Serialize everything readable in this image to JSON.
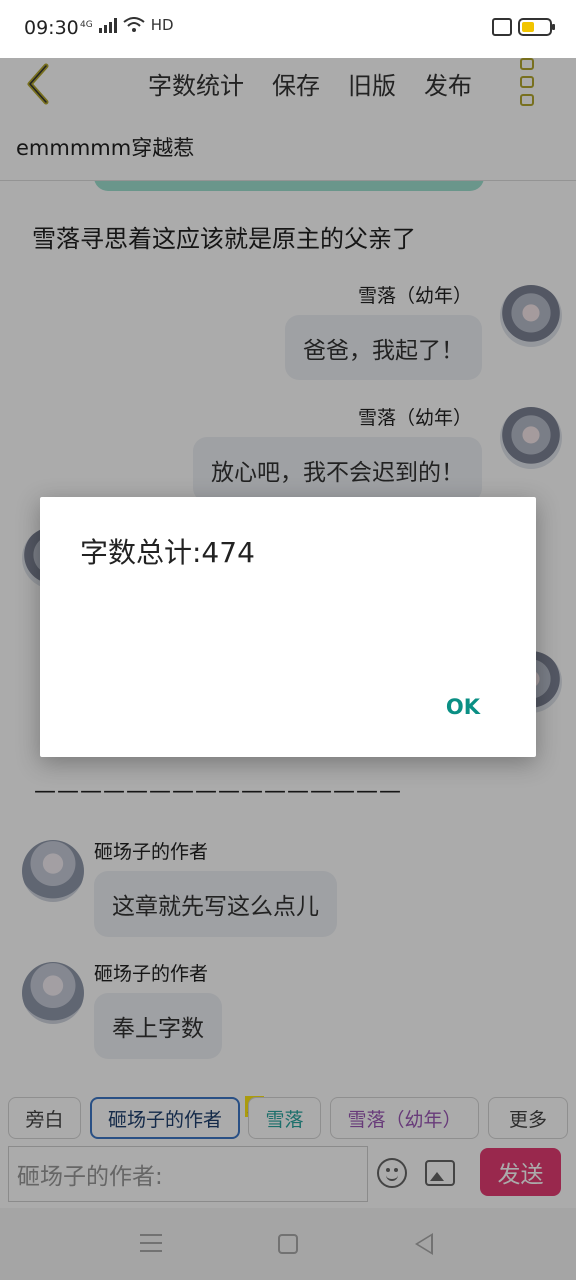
{
  "status_bar": {
    "time": "09:30",
    "network": "4G",
    "hd_label": "HD",
    "battery_color": "#f2c500"
  },
  "toolbar": {
    "back_icon": "chevron-left-icon",
    "items": [
      "字数统计",
      "保存",
      "旧版",
      "发布"
    ],
    "more_icon": "more-vertical-icon",
    "accent_color": "#b3a72f"
  },
  "chapter": {
    "title": "emmmmm穿越惹"
  },
  "chat": {
    "narration": "雪落寻思着这应该就是原主的父亲了",
    "messages": [
      {
        "speaker": "雪落（幼年）",
        "text": "爸爸，我起了！",
        "side": "right"
      },
      {
        "speaker": "雪落（幼年）",
        "text": "放心吧，我不会迟到的！",
        "side": "right"
      },
      {
        "speaker": "砸场子的作者",
        "text": "这章就先写这么点儿",
        "side": "left"
      },
      {
        "speaker": "砸场子的作者",
        "text": "奉上字数",
        "side": "left"
      }
    ],
    "divider": "————————————————"
  },
  "roles": {
    "items": [
      {
        "label": "旁白",
        "color": "#444444"
      },
      {
        "label": "砸场子的作者",
        "color": "#1e3f6e"
      },
      {
        "label": "雪落",
        "color": "#2aa6a0"
      },
      {
        "label": "雪落（幼年）",
        "color": "#9b59b6"
      }
    ],
    "main_tag": "主",
    "more_label": "更多",
    "active_index": 1
  },
  "composer": {
    "placeholder": "砸场子的作者:",
    "send_label": "发送",
    "send_color": "#e43c74"
  },
  "dialog": {
    "message": "字数总计:474",
    "ok_label": "OK",
    "ok_color": "#0a8f84"
  }
}
